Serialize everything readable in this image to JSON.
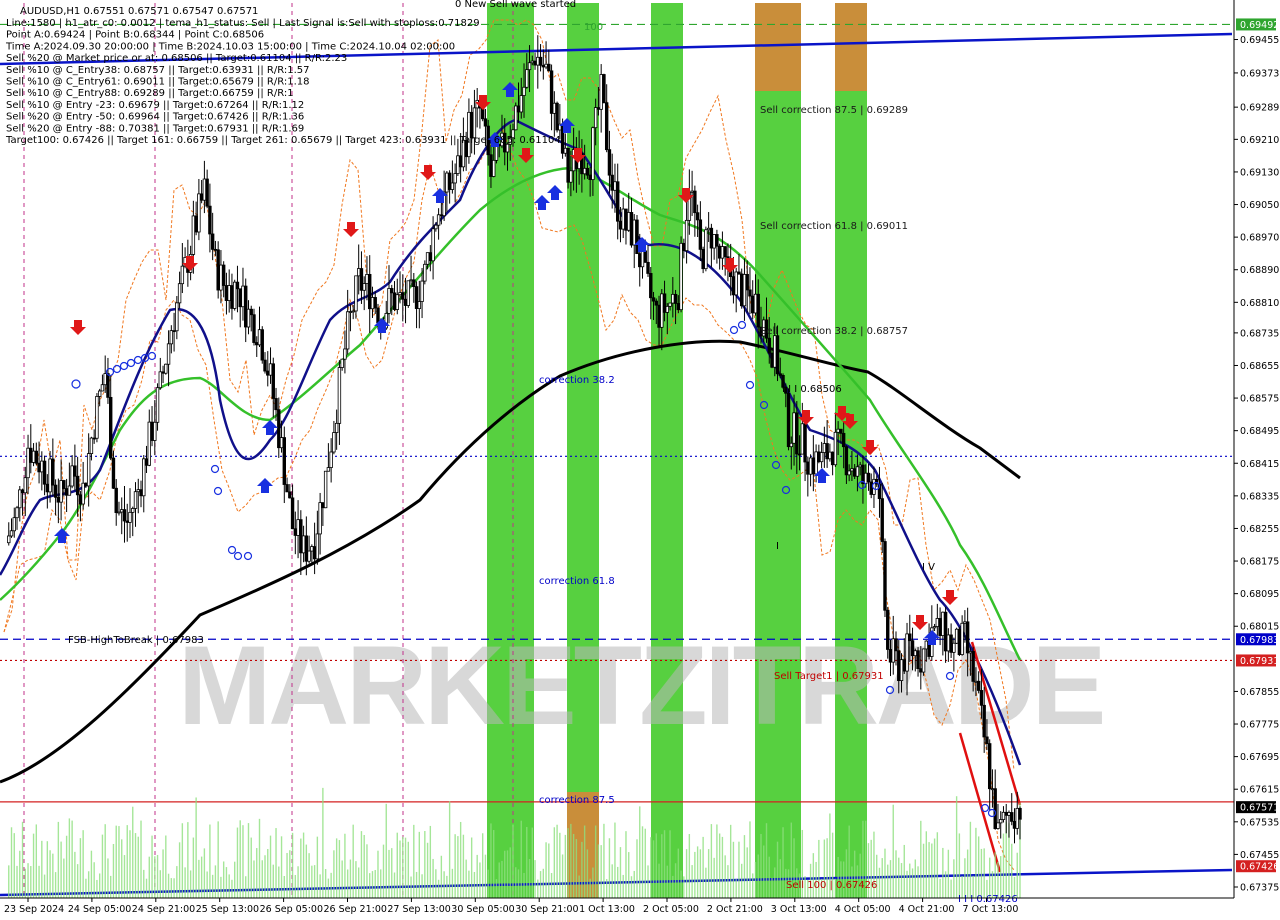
{
  "chart_data": {
    "type": "candlestick",
    "symbol_line": "AUDUSD,H1  0.67551 0.67571 0.67547 0.67571",
    "info_lines": [
      "Line:1580 | h1_atr_c0: 0.0012 | tema_h1_status: Sell | Last Signal is:Sell with stoploss:0.71829",
      "Point A:0.69424 | Point B:0.68344 | Point C:0.68506",
      "Time A:2024.09.30 20:00:00 | Time B:2024.10.03 15:00:00 | Time C:2024.10.04 02:00:00",
      "Sell %20 @ Market price or at: 0.68506 || Target:0.61104 || R/R:2.23",
      "Sell %10 @ C_Entry38: 0.68757 || Target:0.63931 || R/R:1.57",
      "Sell %10 @ C_Entry61: 0.69011 || Target:0.65679 || R/R:1.18",
      "Sell %10 @ C_Entry88: 0.69289 || Target:0.66759 || R/R:1",
      "Sell %10 @ Entry -23: 0.69679 || Target:0.67264 || R/R:1.12",
      "Sell %20 @ Entry -50: 0.69964 || Target:0.67426 || R/R:1.36",
      "Sell %20 @ Entry -88: 0.70381 || Target:0.67931 || R/R:1.69",
      "Target100: 0.67426 || Target 161: 0.66759 || Target 261: 0.65679 || Target 423: 0.63931 || Target 685: 0.61104"
    ],
    "top_label": "0 New Sell wave started",
    "ylim": [
      0.67348,
      0.69552
    ],
    "y_ticks": [
      "0.69455",
      "0.69373",
      "0.69289",
      "0.69210",
      "0.69130",
      "0.69050",
      "0.68970",
      "0.68890",
      "0.68810",
      "0.68735",
      "0.68655",
      "0.68575",
      "0.68495",
      "0.68415",
      "0.68335",
      "0.68255",
      "0.68175",
      "0.68095",
      "0.68015",
      "0.67855",
      "0.67775",
      "0.67695",
      "0.67615",
      "0.67535",
      "0.67455",
      "0.67375"
    ],
    "x_ticks": [
      "23 Sep 2024",
      "24 Sep 05:00",
      "24 Sep 21:00",
      "25 Sep 13:00",
      "26 Sep 05:00",
      "26 Sep 21:00",
      "27 Sep 13:00",
      "30 Sep 05:00",
      "30 Sep 21:00",
      "1 Oct 13:00",
      "2 Oct 05:00",
      "2 Oct 21:00",
      "3 Oct 13:00",
      "4 Oct 05:00",
      "4 Oct 21:00",
      "7 Oct 13:00"
    ],
    "badges": [
      {
        "value": "0.69492",
        "color": "#2fa52f"
      },
      {
        "value": "0.67983",
        "color": "#0000c8"
      },
      {
        "value": "0.67931",
        "color": "#d42020"
      },
      {
        "value": "0.67571",
        "color": "#000000"
      },
      {
        "value": "0.67426",
        "color": "#d42020"
      }
    ],
    "hlines": [
      {
        "value": 0.69492,
        "color": "#2fa52f",
        "style": "dash"
      },
      {
        "value": 0.67983,
        "color": "#0000c8",
        "style": "dash",
        "label": "FSB-HighToBreak | 0.67983"
      },
      {
        "value": 0.67931,
        "color": "#c00000",
        "style": "dot",
        "label": "Sell Target1 | 0.67931"
      },
      {
        "value": 0.67584,
        "color": "#d42020",
        "style": "solid"
      },
      {
        "value": 0.68432,
        "color": "#0000c8",
        "style": "dot"
      }
    ],
    "annotations": [
      {
        "text": "100",
        "color": "#2fa52f"
      },
      {
        "text": "Sell correction 87.5 | 0.69289",
        "color": "#1a1a1a"
      },
      {
        "text": "Sell correction 61.8 | 0.69011",
        "color": "#1a1a1a"
      },
      {
        "text": "Sell correction 38.2 | 0.68757",
        "color": "#1a1a1a"
      },
      {
        "text": "correction 38.2",
        "color": "#0000c8"
      },
      {
        "text": "correction 61.8",
        "color": "#0000c8"
      },
      {
        "text": "correction 87.5",
        "color": "#0000c8"
      },
      {
        "text": "I I I 0.68506",
        "color": "#000000"
      },
      {
        "text": "I V",
        "color": "#000000"
      },
      {
        "text": "I",
        "color": "#000000"
      },
      {
        "text": "Sell 100 | 0.67426",
        "color": "#c00000"
      },
      {
        "text": "I I I 0.67426",
        "color": "#0000c8"
      }
    ],
    "watermark": "MARKETZITRADE",
    "close_series": [
      0.6822,
      0.6829,
      0.6846,
      0.6842,
      0.6838,
      0.6833,
      0.684,
      0.6835,
      0.6852,
      0.6864,
      0.683,
      0.6827,
      0.6835,
      0.6847,
      0.686,
      0.6875,
      0.6886,
      0.6898,
      0.6908,
      0.689,
      0.6884,
      0.6885,
      0.6878,
      0.6874,
      0.6862,
      0.6845,
      0.6826,
      0.682,
      0.6823,
      0.6838,
      0.6856,
      0.6874,
      0.6886,
      0.6884,
      0.6878,
      0.6882,
      0.6881,
      0.6882,
      0.6888,
      0.6902,
      0.6908,
      0.6914,
      0.6924,
      0.6928,
      0.6912,
      0.6918,
      0.6926,
      0.6934,
      0.6942,
      0.6938,
      0.6924,
      0.6912,
      0.6918,
      0.6916,
      0.6932,
      0.691,
      0.69,
      0.6898,
      0.6886,
      0.6878,
      0.688,
      0.6884,
      0.6911,
      0.6892,
      0.6898,
      0.689,
      0.6887,
      0.6883,
      0.6881,
      0.6874,
      0.6866,
      0.685,
      0.6848,
      0.6842,
      0.6842,
      0.6846,
      0.6844,
      0.684,
      0.6836,
      0.684,
      0.6795,
      0.6792,
      0.6796,
      0.6794,
      0.68,
      0.68,
      0.6796,
      0.6798,
      0.6786,
      0.677,
      0.675,
      0.6756,
      0.67571
    ]
  }
}
